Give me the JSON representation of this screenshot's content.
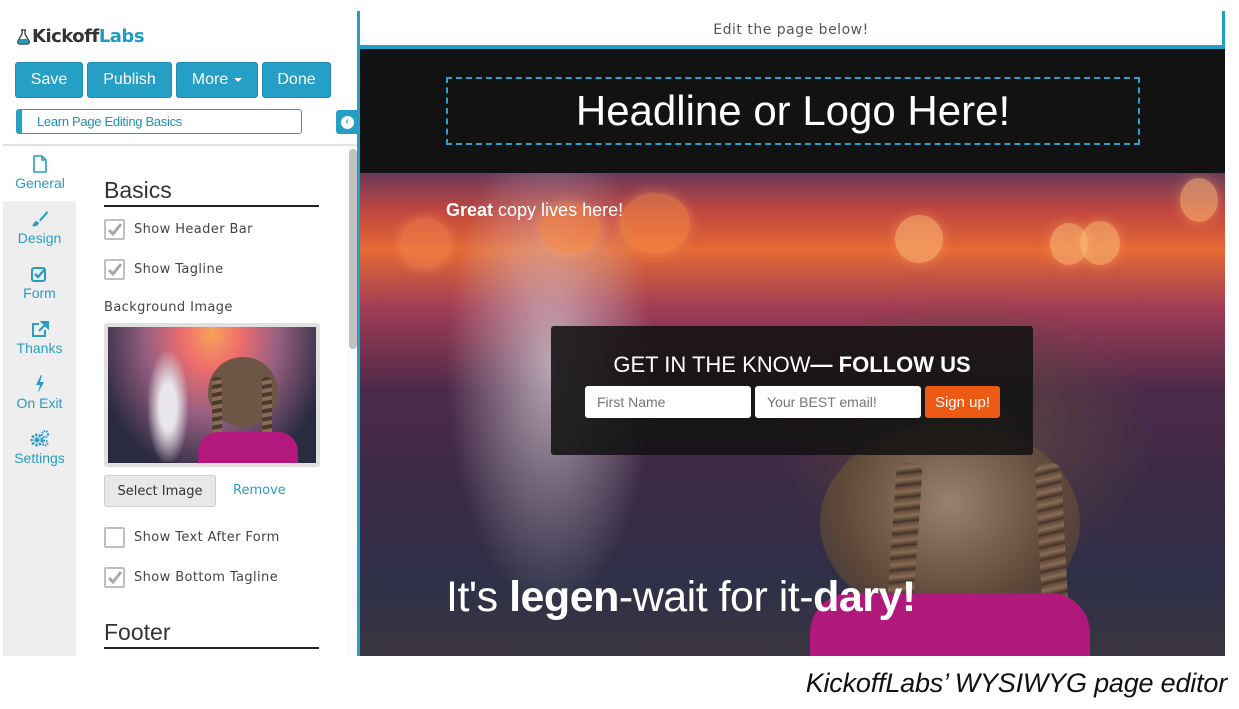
{
  "app": {
    "logo_part1": "Kickoff",
    "logo_part2": "Labs",
    "brand_color": "#259fc6",
    "cta_color": "#ec5a13"
  },
  "toolbar": {
    "save_label": "Save",
    "publish_label": "Publish",
    "more_label": "More",
    "done_label": "Done"
  },
  "help_link": "Learn Page Editing Basics",
  "sidebar": {
    "items": [
      {
        "label": "General",
        "icon": "file-icon",
        "active": true
      },
      {
        "label": "Design",
        "icon": "paintbrush-icon",
        "active": false
      },
      {
        "label": "Form",
        "icon": "checkbox-icon",
        "active": false
      },
      {
        "label": "Thanks",
        "icon": "external-link-icon",
        "active": false
      },
      {
        "label": "On Exit",
        "icon": "lightning-icon",
        "active": false
      },
      {
        "label": "Settings",
        "icon": "gears-icon",
        "active": false
      }
    ]
  },
  "basics": {
    "title": "Basics",
    "options": [
      {
        "label": "Show Header Bar",
        "checked": true
      },
      {
        "label": "Show Tagline",
        "checked": true
      }
    ],
    "background_label": "Background Image",
    "select_image_label": "Select Image",
    "remove_label": "Remove",
    "options_after": [
      {
        "label": "Show Text After Form",
        "checked": false
      },
      {
        "label": "Show Bottom Tagline",
        "checked": true
      }
    ]
  },
  "footer": {
    "title": "Footer"
  },
  "preview": {
    "instruction": "Edit the page below!",
    "headline": "Headline or Logo Here!",
    "tagline_bold": "Great",
    "tagline_rest": " copy lives here!",
    "form": {
      "title_regular": "GET IN THE KNOW",
      "title_dash": "— ",
      "title_bold": "FOLLOW US",
      "first_name_placeholder": "First Name",
      "email_placeholder": "Your BEST email!",
      "signup_label": "Sign up!"
    },
    "bottom_tagline": {
      "part1": "It's ",
      "part2_bold": "legen",
      "part3": "-wait for it-",
      "part4_bold": "dary!"
    }
  },
  "caption": "KickoffLabs’ WYSIWYG page editor"
}
